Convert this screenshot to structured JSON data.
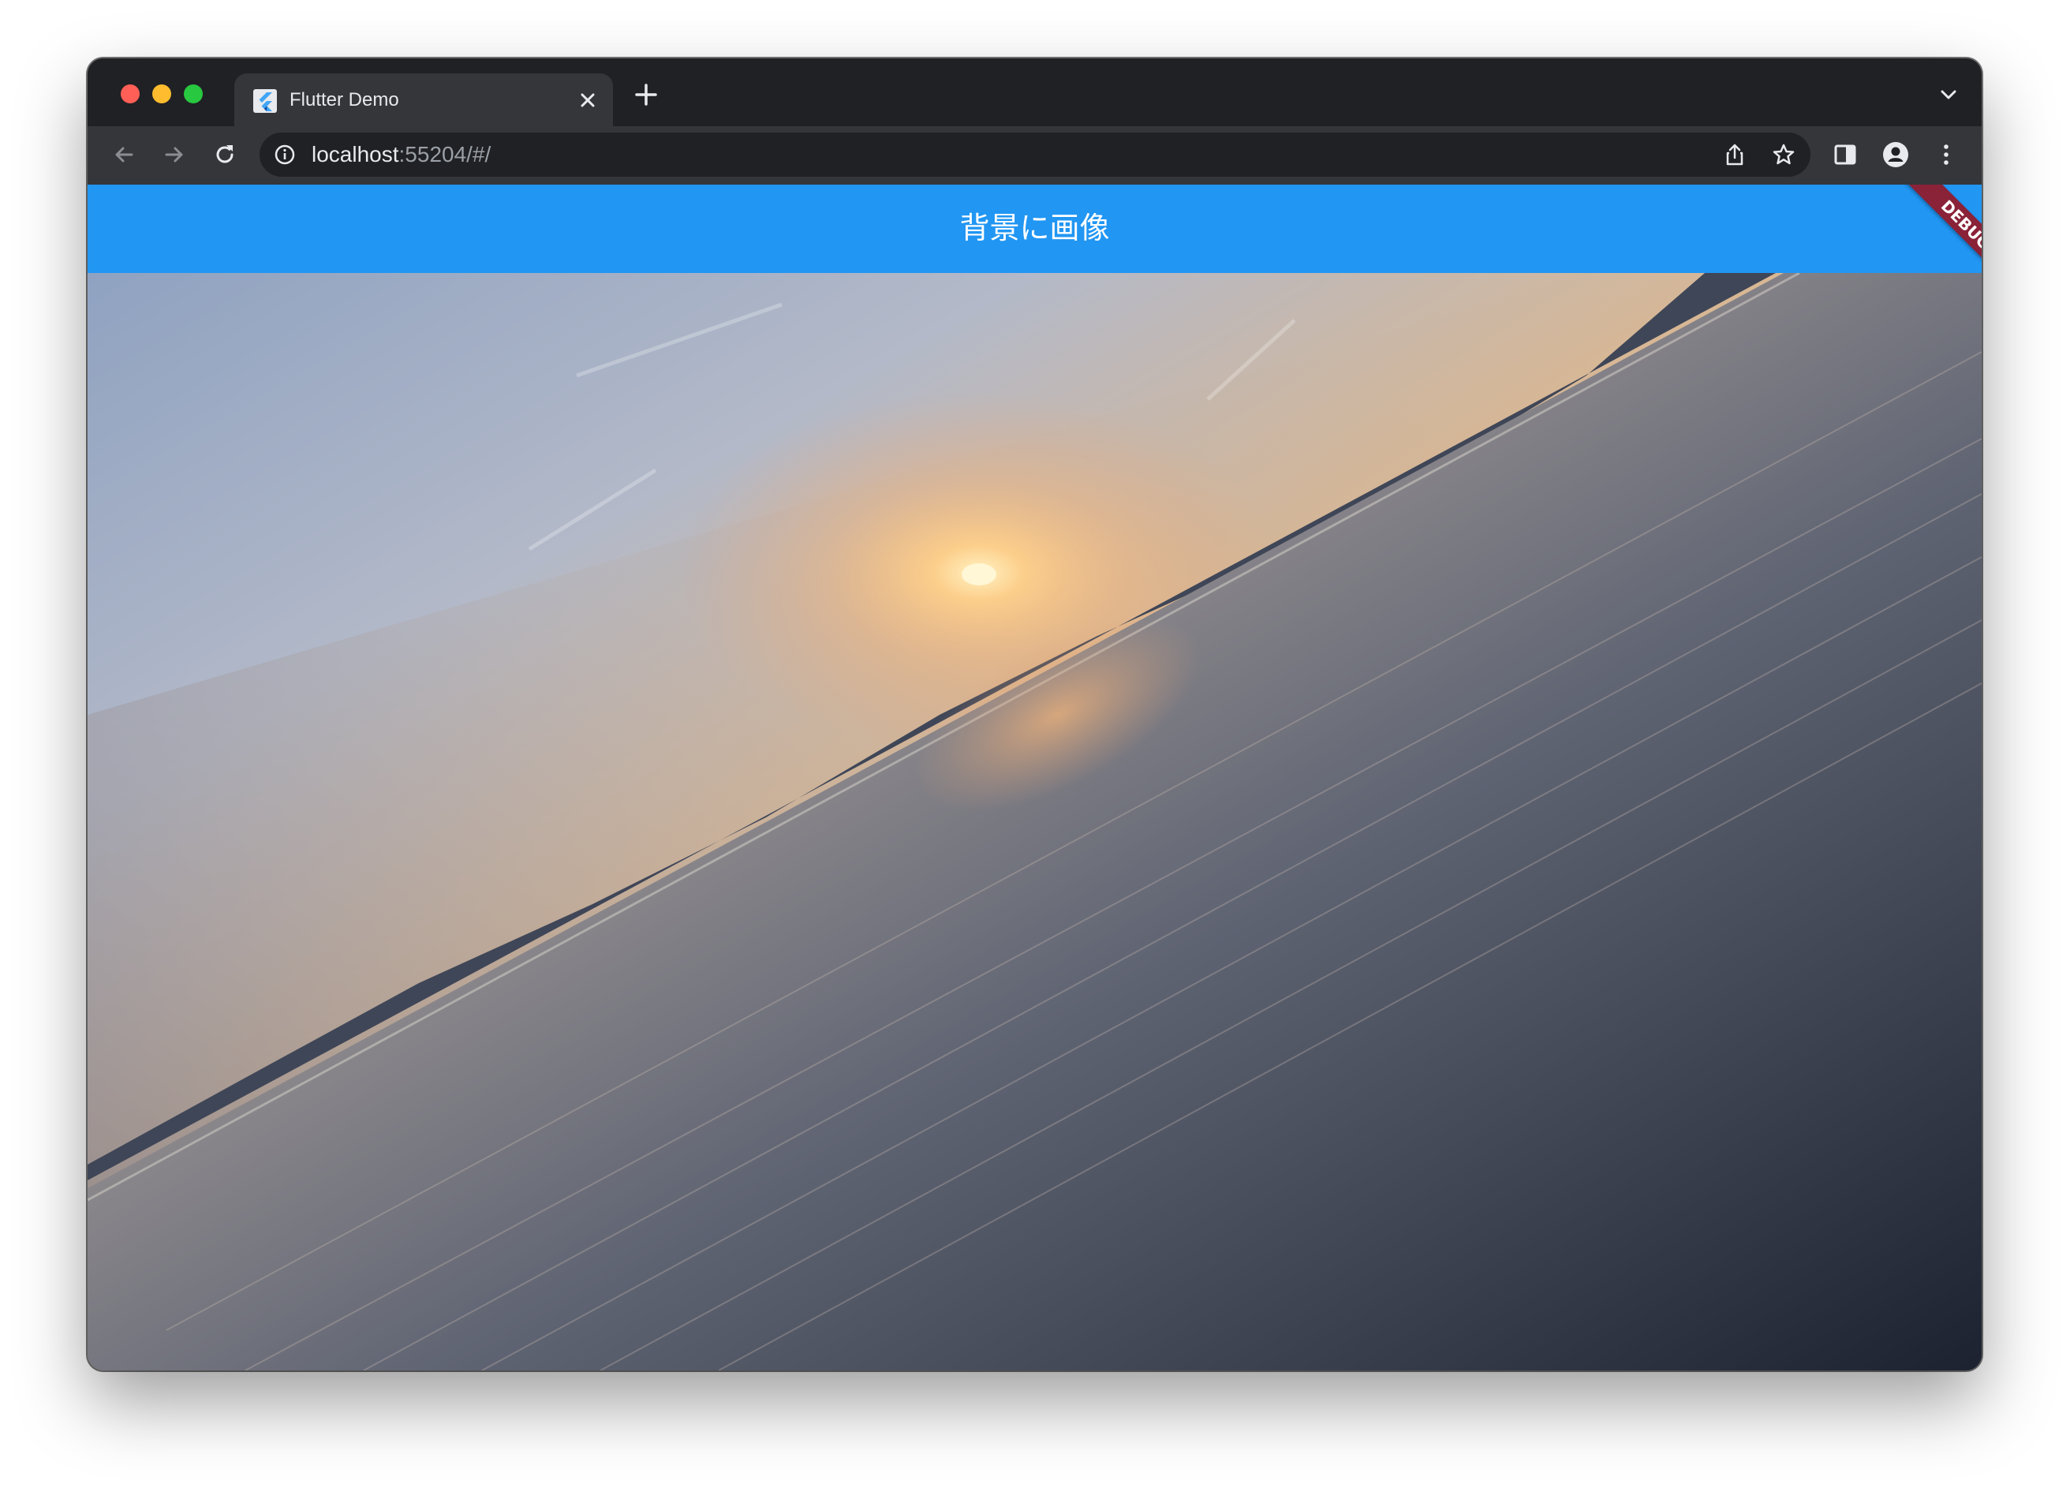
{
  "window": {
    "traffic_lights": [
      "close",
      "minimize",
      "maximize"
    ]
  },
  "tab": {
    "title": "Flutter Demo",
    "favicon": "flutter-logo-icon",
    "close_icon": "close-icon"
  },
  "toolbar": {
    "new_tab_icon": "plus-icon",
    "tab_search_icon": "chevron-down-icon",
    "back_icon": "arrow-left-icon",
    "forward_icon": "arrow-right-icon",
    "reload_icon": "reload-icon",
    "side_panel_icon": "side-panel-icon",
    "profile_icon": "profile-icon",
    "menu_icon": "kebab-menu-icon"
  },
  "omnibox": {
    "host": "localhost",
    "rest": ":55204/#/",
    "info_icon": "info-icon",
    "share_icon": "share-icon",
    "bookmark_icon": "star-icon"
  },
  "app": {
    "title": "背景に画像",
    "debug_banner": "DEBUG",
    "appbar_color": "#2196f3",
    "background_image": "sunset-over-lake-tilted"
  },
  "colors": {
    "chrome_dark": "#202124",
    "chrome_toolbar": "#35363a",
    "debug_ribbon": "#8a2238"
  }
}
